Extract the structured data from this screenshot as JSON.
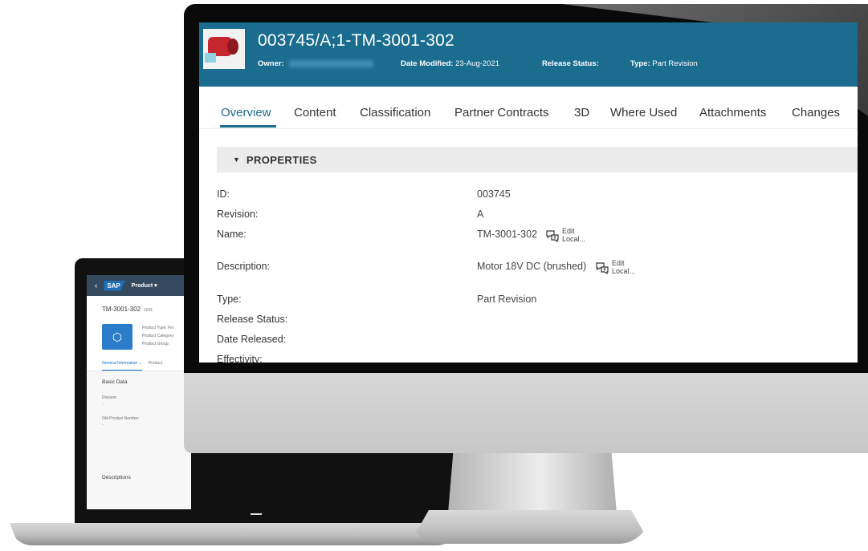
{
  "laptop": {
    "header": {
      "back": "‹",
      "logo": "SAP",
      "product_menu": "Product ▾"
    },
    "title": "TM-3001-302",
    "title_code": "1001",
    "attrs": [
      "Product Type: Fin",
      "Product Category:",
      "Product Group:"
    ],
    "tabs": [
      "General Information ⌄",
      "Product"
    ],
    "section": "Basic Data",
    "fields": [
      {
        "label": "Division:",
        "value": "-"
      },
      {
        "label": "Old Product Number:",
        "value": "-"
      }
    ],
    "bottom_section": "Descriptions"
  },
  "header": {
    "title": "003745/A;1-TM-3001-302",
    "owner_label": "Owner:",
    "date_modified_label": "Date Modified:",
    "date_modified_value": "23-Aug-2021",
    "release_status_label": "Release Status:",
    "type_label": "Type:",
    "type_value": "Part Revision"
  },
  "tabs": [
    "Overview",
    "Content",
    "Classification",
    "Partner Contracts",
    "3D",
    "Where Used",
    "Attachments",
    "Changes"
  ],
  "active_tab": "Overview",
  "properties": {
    "section_title": "PROPERTIES",
    "rows": [
      {
        "label": "ID:",
        "value": "003745"
      },
      {
        "label": "Revision:",
        "value": "A"
      },
      {
        "label": "Name:",
        "value": "TM-3001-302"
      },
      {
        "label": "Description:",
        "value": "Motor 18V DC (brushed)"
      },
      {
        "label": "Type:",
        "value": "Part Revision"
      },
      {
        "label": "Release Status:",
        "value": ""
      },
      {
        "label": "Date Released:",
        "value": ""
      },
      {
        "label": "Effectivity:",
        "value": ""
      }
    ],
    "edit_local": {
      "line1": "Edit",
      "line2": "Local..."
    }
  },
  "colors": {
    "header_bg": "#1b6d8f",
    "accent": "#1b6d8f",
    "section_bg": "#ececec",
    "sap_shell": "#354a5f"
  }
}
